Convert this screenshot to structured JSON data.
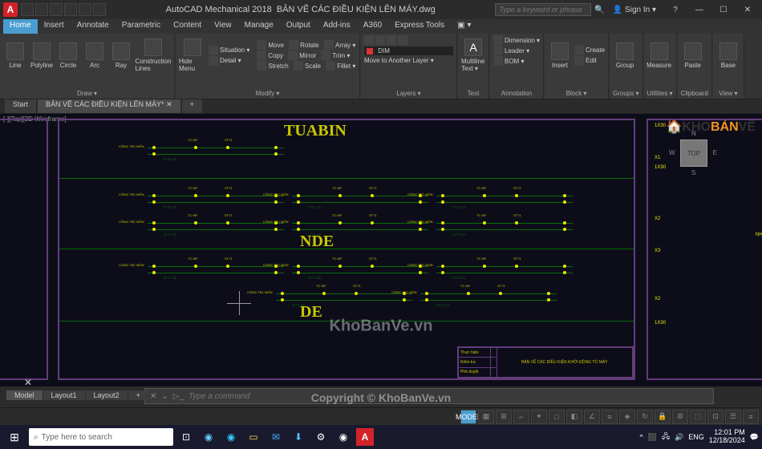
{
  "title": {
    "app": "AutoCAD Mechanical 2018",
    "file": "BẢN VẼ CÁC ĐIỀU KIỆN LÊN MÁY.dwg",
    "search_ph": "Type a keyword or phrase",
    "sign_in": "Sign In"
  },
  "ribbon_tabs": [
    "Home",
    "Insert",
    "Annotate",
    "Parametric",
    "Content",
    "View",
    "Manage",
    "Output",
    "Add-ins",
    "A360",
    "Express Tools"
  ],
  "panels": {
    "draw": {
      "items": [
        "Line",
        "Polyline",
        "Circle",
        "Arc",
        "Ray",
        "Construction Lines"
      ],
      "title": "Draw ▾"
    },
    "modify": {
      "rows": [
        [
          "Move",
          "Rotate",
          "Array ▾"
        ],
        [
          "Copy",
          "Mirror",
          "Trim ▾"
        ],
        [
          "Stretch",
          "Scale",
          "Fillet ▾"
        ]
      ],
      "extra": [
        "Situation ▾",
        "Detail ▾",
        "Hide Menu"
      ],
      "title": "Modify ▾"
    },
    "layers": {
      "rows": [
        "DIM",
        "Move to Another Layer ▾"
      ],
      "title": "Layers ▾"
    },
    "text": "Text",
    "ml": "Multiline Text ▾",
    "annotation": {
      "rows": [
        "Dimension ▾",
        "Leader ▾",
        "BOM ▾"
      ],
      "title": "Annotation"
    },
    "block": {
      "rows": [
        "Insert",
        "Create",
        "Edit"
      ],
      "title": "Block ▾"
    },
    "group": {
      "title": "Groups ▾",
      "btn": "Group"
    },
    "util": {
      "title": "Utilities ▾",
      "btn": "Measure"
    },
    "clip": {
      "title": "Clipboard",
      "btn": "Paste"
    },
    "view": {
      "title": "View ▾",
      "btn": "Base"
    }
  },
  "doc_tabs": [
    "Start",
    "BẢN VẼ CÁC ĐIỀU KIỆN LÊN MÁY*"
  ],
  "viewport": "[-][Top][2D Wireframe]",
  "sections": {
    "tuabin": "TUABIN",
    "nde": "NDE",
    "de": "DE"
  },
  "circuit_labels": {
    "congtac": "CÔNG TẮC MÔN",
    "tcmf": "TC MF",
    "stt": "STT1",
    "sttde": "STT1 DE"
  },
  "right_labels": {
    "x1": "X1",
    "x2": "X2",
    "x3": "X3",
    "ix30": "1X30",
    "nhiet": "NHIỆT",
    "n": "N",
    "e": "E",
    "s": "S",
    "w": "W",
    "top": "TOP"
  },
  "title_block": {
    "thuc": "Thực hiện",
    "kiem": "Kiểm tra",
    "phe": "Phê duyệt",
    "title": "BẢN VẼ CÁC ĐIỀU KIỆN KHỞI ĐỘNG TỔ MÁY"
  },
  "watermark": "KhoBanVe.vn",
  "copyright": "Copyright © KhoBanVe.vn",
  "layout_tabs": [
    "Model",
    "Layout1",
    "Layout2",
    "+"
  ],
  "cmd_ph": "Type a command",
  "status": {
    "model": "MODEL"
  },
  "taskbar": {
    "search": "Type here to search",
    "time": "12:01 PM",
    "date": "12/18/2024"
  },
  "logo": {
    "kho": "KHO",
    "ban": "BẢN",
    "ve": "VẼ"
  }
}
